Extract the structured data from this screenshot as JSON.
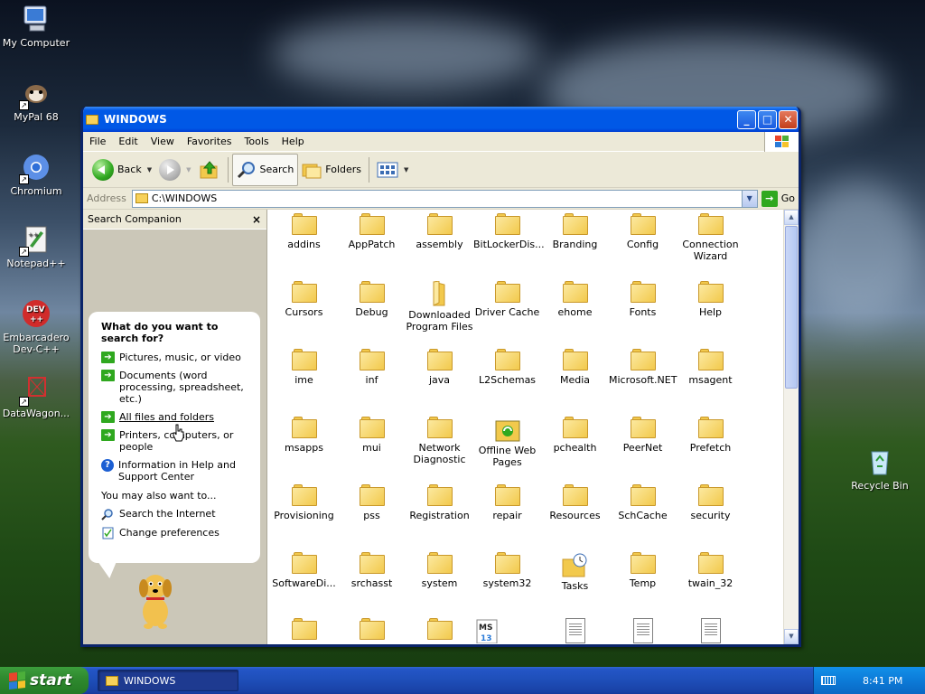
{
  "desktop": {
    "icons": [
      {
        "label": "My Computer",
        "icon": "my-computer-icon"
      },
      {
        "label": "MyPal 68",
        "icon": "mypal-icon"
      },
      {
        "label": "Chromium",
        "icon": "chromium-icon"
      },
      {
        "label": "Notepad++",
        "icon": "notepadpp-icon"
      },
      {
        "label": "Embarcadero Dev-C++",
        "icon": "devcpp-icon"
      },
      {
        "label": "DataWagon...",
        "icon": "datawagon-icon"
      },
      {
        "label": "Recycle Bin",
        "icon": "recycle-bin-icon"
      }
    ]
  },
  "window": {
    "title": "WINDOWS",
    "menu": [
      "File",
      "Edit",
      "View",
      "Favorites",
      "Tools",
      "Help"
    ],
    "toolbar": {
      "back": "Back",
      "search": "Search",
      "folders": "Folders"
    },
    "address": {
      "label": "Address",
      "value": "C:\\WINDOWS",
      "go": "Go"
    }
  },
  "companion": {
    "header": "Search Companion",
    "close": "×",
    "question": "What do you want to search for?",
    "options": [
      "Pictures, music, or video",
      "Documents (word processing, spreadsheet, etc.)",
      "All files and folders",
      "Printers, computers, or people",
      "Information in Help and Support Center"
    ],
    "also_label": "You may also want to...",
    "also": [
      "Search the Internet",
      "Change preferences"
    ]
  },
  "files": [
    "addins",
    "AppPatch",
    "assembly",
    "BitLockerDis...",
    "Branding",
    "Config",
    "Connection Wizard",
    "Cursors",
    "Debug",
    "Downloaded Program Files",
    "Driver Cache",
    "ehome",
    "Fonts",
    "Help",
    "ime",
    "inf",
    "java",
    "L2Schemas",
    "Media",
    "Microsoft.NET",
    "msagent",
    "msapps",
    "mui",
    "Network Diagnostic",
    "Offline Web Pages",
    "pchealth",
    "PeerNet",
    "Prefetch",
    "Provisioning",
    "pss",
    "Registration",
    "repair",
    "Resources",
    "SchCache",
    "security",
    "SoftwareDi...",
    "srchasst",
    "system",
    "system32",
    "Tasks",
    "Temp",
    "twain_32"
  ],
  "taskbar": {
    "start": "start",
    "task": "WINDOWS",
    "clock": "8:41 PM"
  }
}
